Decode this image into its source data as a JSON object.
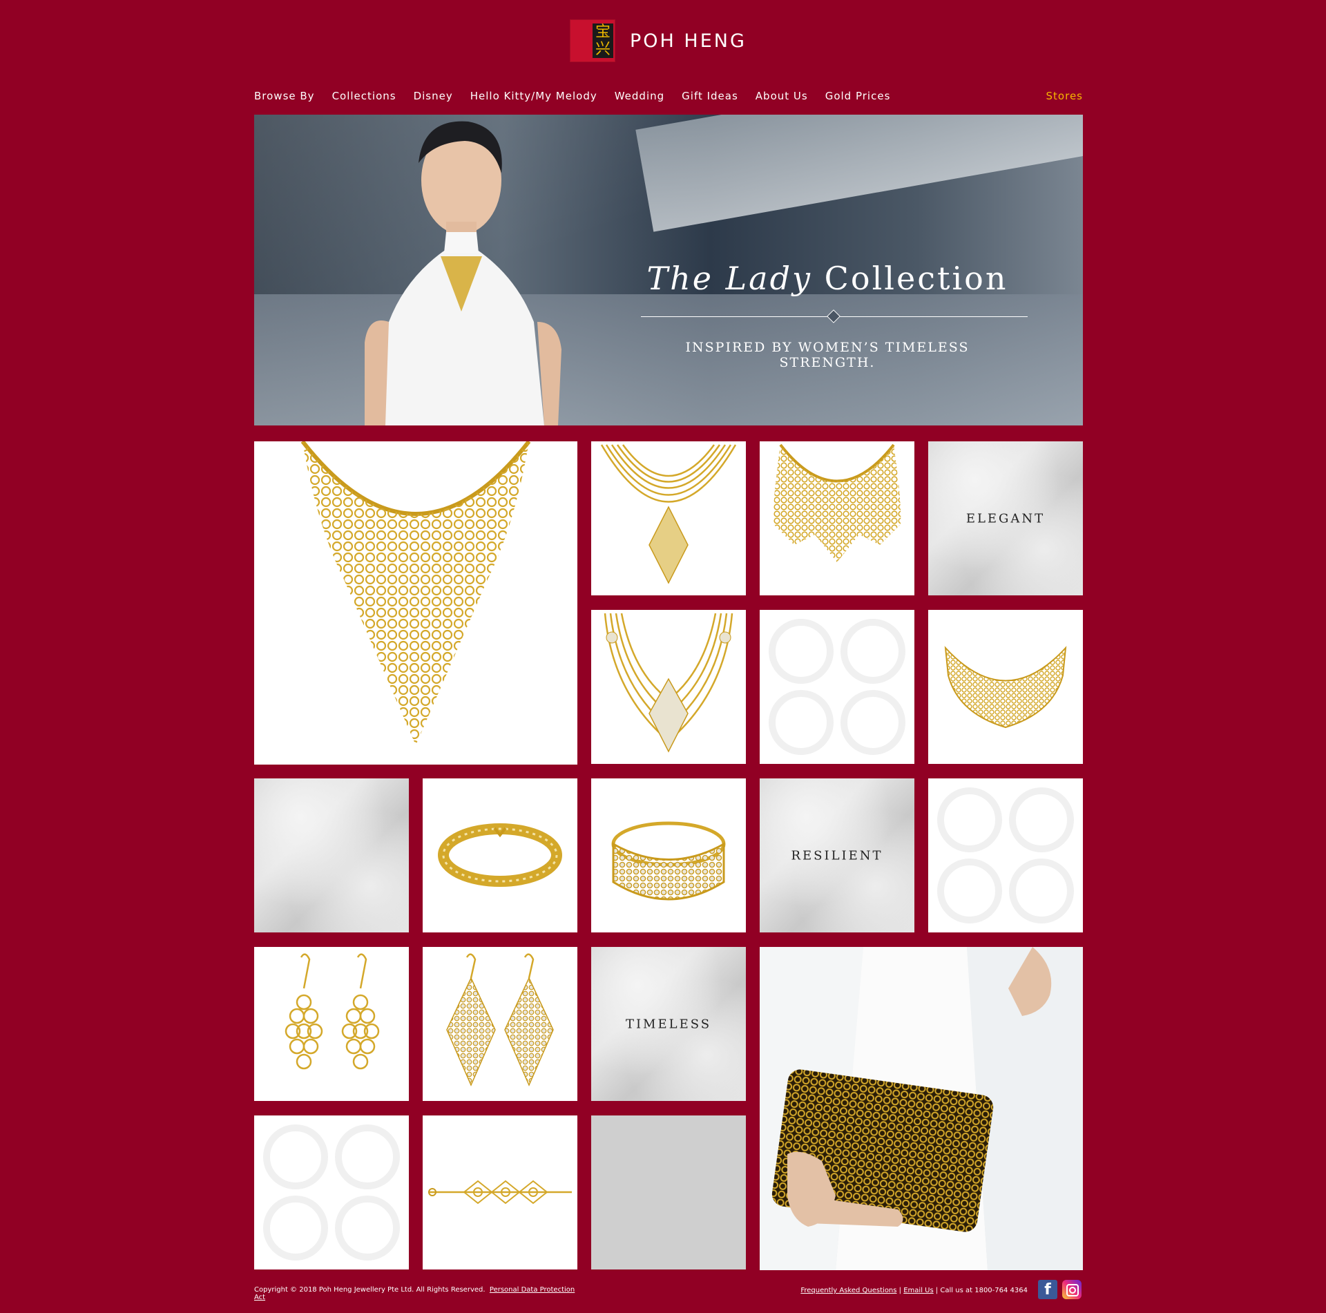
{
  "brand": {
    "name": "POH HENG",
    "logo_glyphs": [
      "宝",
      "兴"
    ],
    "colors": {
      "background": "#910024",
      "accent": "#f6b700",
      "gold": "#d4a82a"
    }
  },
  "nav": {
    "items": [
      "Browse By",
      "Collections",
      "Disney",
      "Hello Kitty/My Melody",
      "Wedding",
      "Gift Ideas",
      "About Us",
      "Gold Prices"
    ],
    "stores": "Stores"
  },
  "hero": {
    "title_italic": "The Lady",
    "title_rest": "Collection",
    "subtitle": "INSPIRED BY WOMEN’S TIMELESS STRENGTH."
  },
  "tiles": {
    "elegant": "ELEGANT",
    "resilient": "RESILIENT",
    "timeless": "TIMELESS"
  },
  "footer": {
    "copyright": "Copyright © 2018 Poh Heng Jewellery Pte Ltd. All Rights Reserved.",
    "pdpa_link": "Personal Data Protection Act",
    "faq_link": "Frequently Asked Questions",
    "separator": "|",
    "email_link": "Email Us",
    "call_text": "| Call us at 1800-764 4364"
  },
  "social": {
    "facebook_icon": "facebook-icon",
    "instagram_icon": "instagram-icon",
    "facebook_glyph": "f"
  }
}
